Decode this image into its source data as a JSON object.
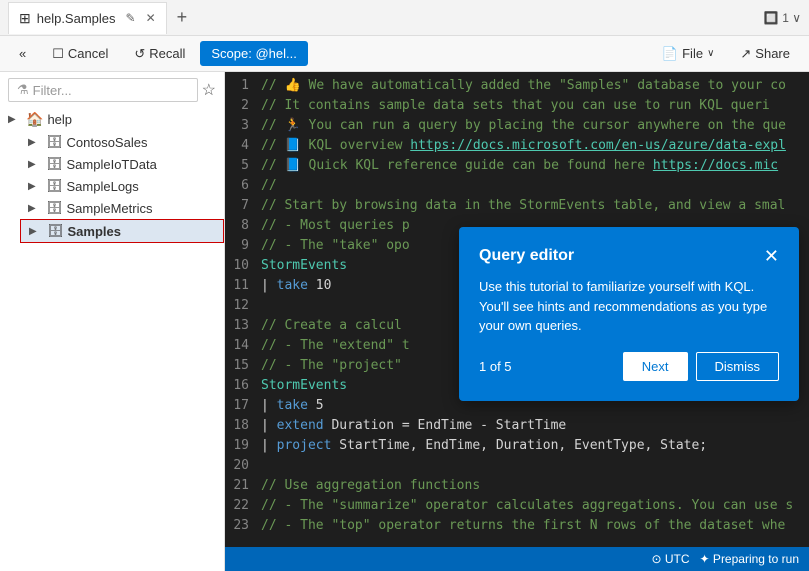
{
  "titleBar": {
    "tab": {
      "label": "help.Samples",
      "editIcon": "✎",
      "closeIcon": "✕"
    },
    "addTabIcon": "+",
    "rightInfo": "🔲 1 ∨"
  },
  "toolbar": {
    "collapseIcon": "«",
    "cancelLabel": "Cancel",
    "recallIcon": "↺",
    "recallLabel": "Recall",
    "scopeLabel": "Scope: @hel...",
    "fileLabel": "File",
    "fileDropIcon": "∨",
    "shareIcon": "↗",
    "shareLabel": "Share"
  },
  "sidebar": {
    "filterPlaceholder": "Filter...",
    "filterIcon": "⚗",
    "starIcon": "☆",
    "tree": {
      "rootLabel": "help",
      "items": [
        {
          "id": "contosoSales",
          "label": "ContosoSales",
          "icon": "🗄"
        },
        {
          "id": "sampleIoTData",
          "label": "SampleIoTData",
          "icon": "🗄"
        },
        {
          "id": "sampleLogs",
          "label": "SampleLogs",
          "icon": "🗄"
        },
        {
          "id": "sampleMetrics",
          "label": "SampleMetrics",
          "icon": "🗄"
        },
        {
          "id": "samples",
          "label": "Samples",
          "icon": "🗄",
          "selected": true
        }
      ]
    }
  },
  "editor": {
    "lines": [
      {
        "num": 1,
        "text": "// 👍 We have automatically added the \"Samples\" database to your co"
      },
      {
        "num": 2,
        "text": "//    It contains sample data sets that you can use to run KQL queri"
      },
      {
        "num": 3,
        "text": "// 🏃 You can run a query by placing the cursor anywhere on the que"
      },
      {
        "num": 4,
        "text": "// 📘 KQL overview https://docs.microsoft.com/en-us/azure/data-expl"
      },
      {
        "num": 5,
        "text": "// 📘 Quick KQL reference guide can be found here https://docs.mic"
      },
      {
        "num": 6,
        "text": "//"
      },
      {
        "num": 7,
        "text": "// Start by browsing data in the StormEvents table, and view a smal"
      },
      {
        "num": 8,
        "text": "// - Most queries p"
      },
      {
        "num": 9,
        "text": "// - The \"take\" opo"
      },
      {
        "num": 10,
        "text": "StormEvents"
      },
      {
        "num": 11,
        "text": "| take 10"
      },
      {
        "num": 12,
        "text": ""
      },
      {
        "num": 13,
        "text": "// Create a calcul"
      },
      {
        "num": 14,
        "text": "// - The \"extend\" t"
      },
      {
        "num": 15,
        "text": "// - The \"project\""
      },
      {
        "num": 16,
        "text": "StormEvents"
      },
      {
        "num": 17,
        "text": "| take 5"
      },
      {
        "num": 18,
        "text": "| extend Duration = EndTime - StartTime"
      },
      {
        "num": 19,
        "text": "| project StartTime, EndTime, Duration, EventType, State;"
      },
      {
        "num": 20,
        "text": ""
      },
      {
        "num": 21,
        "text": "// Use aggregation functions"
      },
      {
        "num": 22,
        "text": "// - The \"summarize\" operator calculates aggregations. You can use s"
      },
      {
        "num": 23,
        "text": "// - The \"top\" operator returns the first N rows of the dataset whe"
      }
    ]
  },
  "popup": {
    "title": "Query editor",
    "closeIcon": "✕",
    "body": "Use this tutorial to familiarize yourself with KQL. You'll see hints and recommendations as you type your own queries.",
    "pageInfo": "1 of 5",
    "nextLabel": "Next",
    "dismissLabel": "Dismiss"
  },
  "statusBar": {
    "utcLabel": "⊙ UTC",
    "spinnerLabel": "✦ Preparing to run"
  }
}
